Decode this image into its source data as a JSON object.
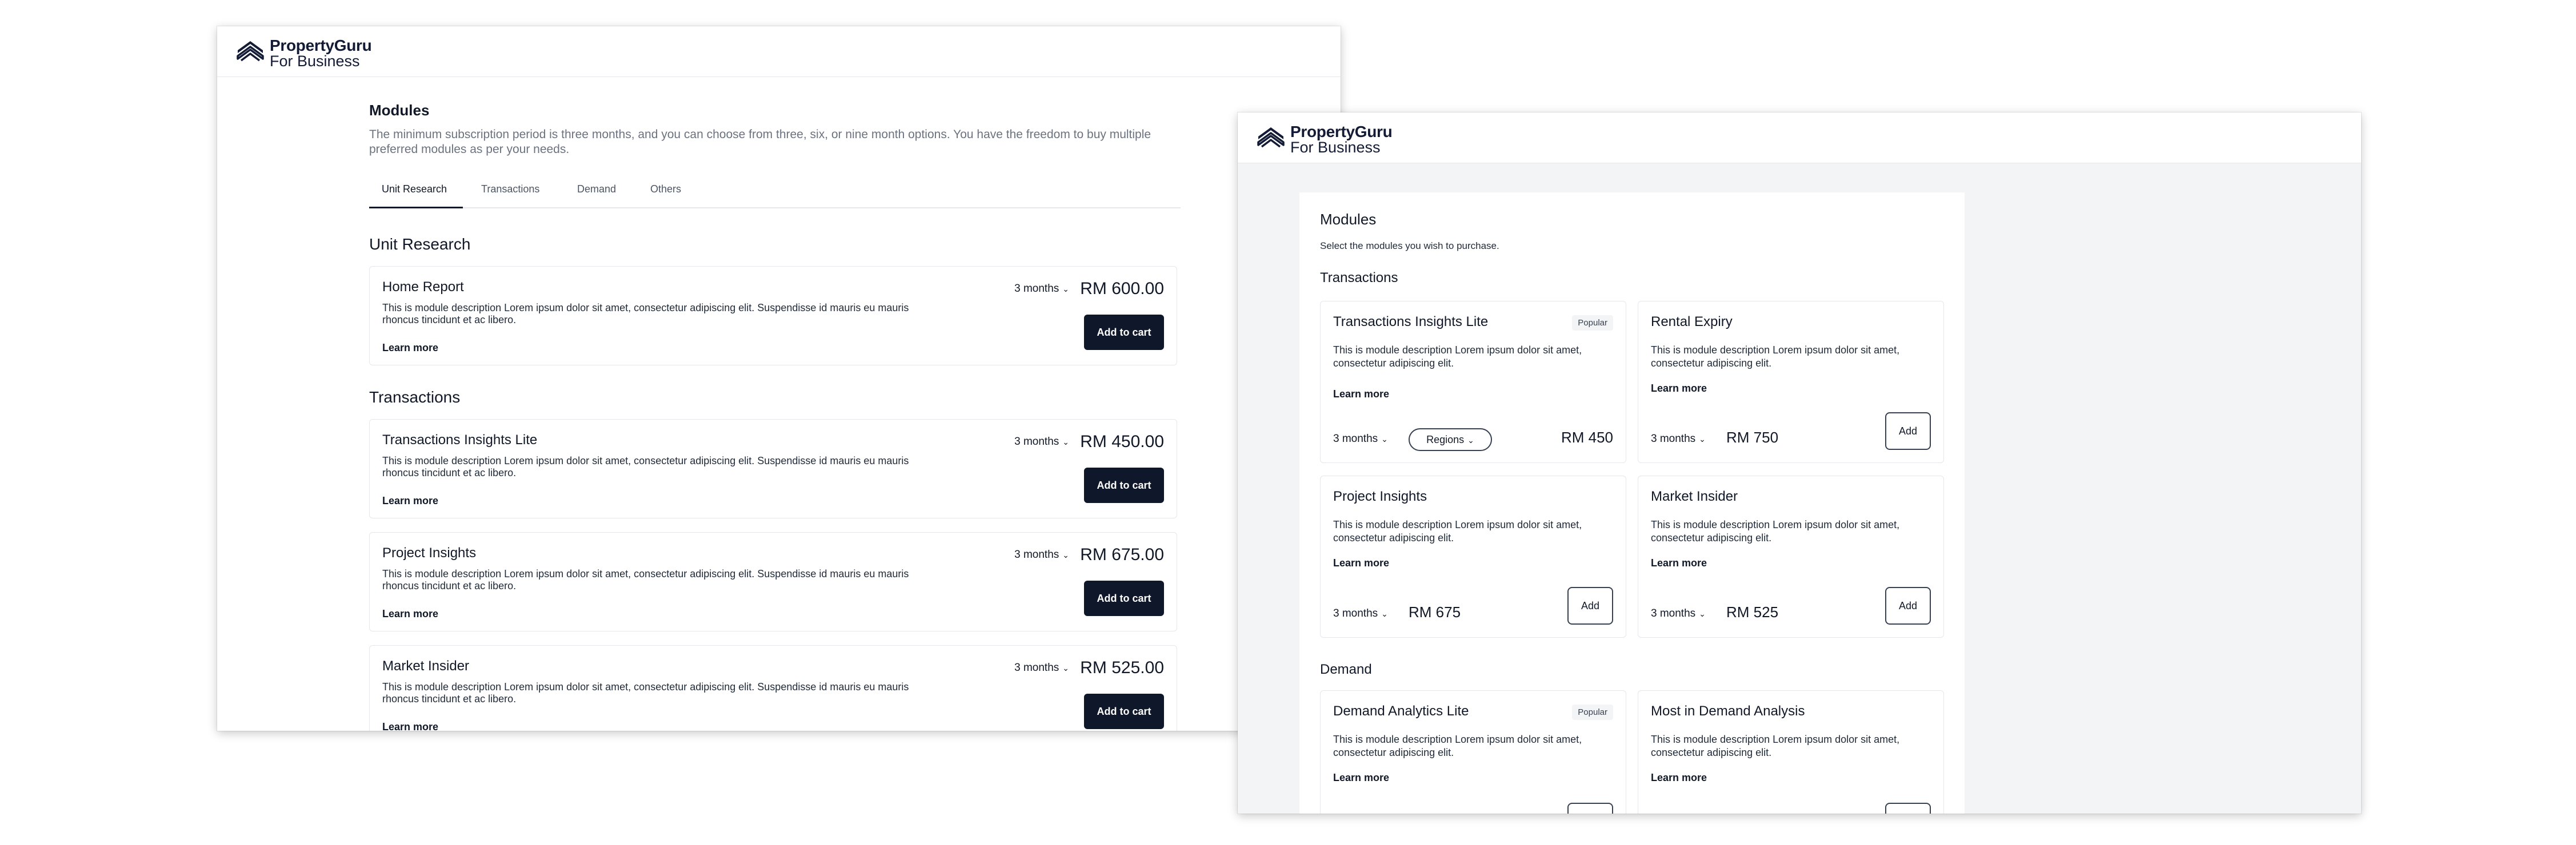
{
  "brand": {
    "line1": "PropertyGuru",
    "line2": "For Business"
  },
  "left": {
    "heading": "Modules",
    "intro": "The minimum subscription period is three months, and you can choose from three, six, or nine month options. You have the freedom to buy multiple preferred modules as per your needs.",
    "tabs": [
      "Unit Research",
      "Transactions",
      "Demand",
      "Others"
    ],
    "sections": [
      "Unit Research",
      "Transactions"
    ],
    "cards": [
      {
        "title": "Home Report",
        "desc": "This is module description Lorem ipsum dolor sit amet, consectetur adipiscing elit. Suspendisse id mauris eu mauris rhoncus tincidunt et ac libero.",
        "learn": "Learn more",
        "duration": "3 months",
        "price": "RM 600.00",
        "button": "Add to cart"
      },
      {
        "title": "Transactions Insights Lite",
        "desc": "This is module description Lorem ipsum dolor sit amet, consectetur adipiscing elit. Suspendisse id mauris eu mauris rhoncus tincidunt et ac libero.",
        "learn": "Learn more",
        "duration": "3 months",
        "price": "RM 450.00",
        "button": "Add to cart"
      },
      {
        "title": "Project Insights",
        "desc": "This is module description Lorem ipsum dolor sit amet, consectetur adipiscing elit. Suspendisse id mauris eu mauris rhoncus tincidunt et ac libero.",
        "learn": "Learn more",
        "duration": "3 months",
        "price": "RM 675.00",
        "button": "Add to cart"
      },
      {
        "title": "Market Insider",
        "desc": "This is module description Lorem ipsum dolor sit amet, consectetur adipiscing elit. Suspendisse id mauris eu mauris rhoncus tincidunt et ac libero.",
        "learn": "Learn more",
        "duration": "3 months",
        "price": "RM 525.00",
        "button": "Add to cart"
      }
    ]
  },
  "right": {
    "heading": "Modules",
    "subheading": "Select the modules you wish to purchase.",
    "sections": [
      "Transactions",
      "Demand"
    ],
    "cards": [
      {
        "title": "Transactions Insights Lite",
        "badge": "Popular",
        "desc": "This is module description Lorem ipsum dolor sit amet, consectetur adipiscing elit.",
        "learn": "Learn more",
        "duration": "3 months",
        "region": "Regions",
        "price": "RM 450"
      },
      {
        "title": "Rental Expiry",
        "desc": "This is module description Lorem ipsum dolor sit amet, consectetur adipiscing elit.",
        "learn": "Learn more",
        "duration": "3 months",
        "price": "RM 750",
        "button": "Add"
      },
      {
        "title": "Project Insights",
        "desc": "This is module description Lorem ipsum dolor sit amet, consectetur adipiscing elit.",
        "learn": "Learn more",
        "duration": "3 months",
        "price": "RM 675",
        "button": "Add"
      },
      {
        "title": "Market Insider",
        "desc": "This is module description Lorem ipsum dolor sit amet, consectetur adipiscing elit.",
        "learn": "Learn more",
        "duration": "3 months",
        "price": "RM 525",
        "button": "Add"
      },
      {
        "title": "Demand Analytics Lite",
        "badge": "Popular",
        "desc": "This is module description Lorem ipsum dolor sit amet, consectetur adipiscing elit.",
        "learn": "Learn more"
      },
      {
        "title": "Most in Demand Analysis",
        "desc": "This is module description Lorem ipsum dolor sit amet, consectetur adipiscing elit.",
        "learn": "Learn more"
      }
    ]
  },
  "colors": {
    "primary": "#0f172a",
    "text": "#111827",
    "muted": "#6b7280",
    "border": "#e5e7eb",
    "panel_bg": "#f3f4f6"
  },
  "icons": {
    "logo": "propertyguru-logo-icon",
    "chevron": "chevron-down-icon"
  }
}
